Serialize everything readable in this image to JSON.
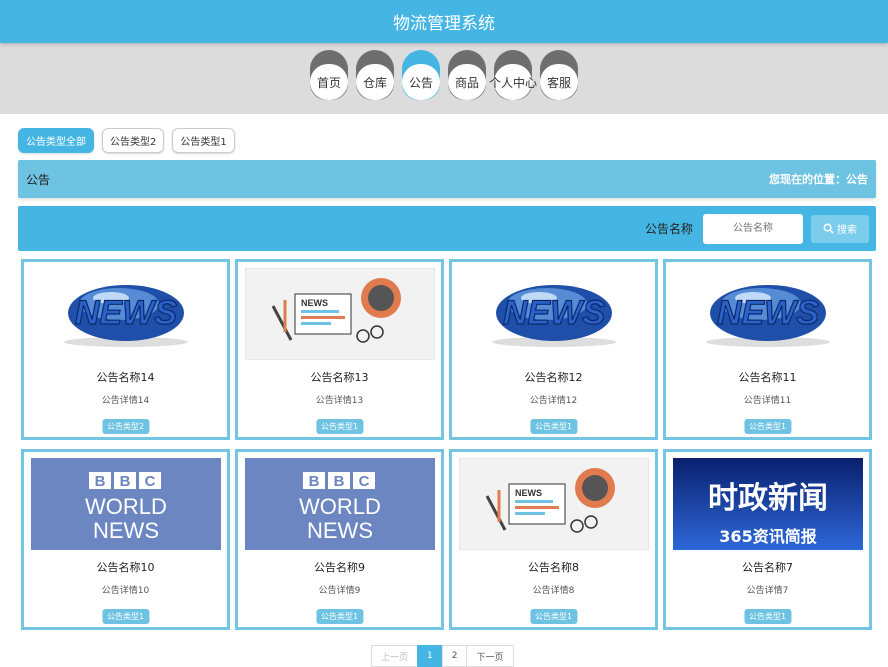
{
  "header": {
    "title": "物流管理系统"
  },
  "nav": [
    {
      "label": "首页"
    },
    {
      "label": "仓库"
    },
    {
      "label": "公告",
      "active": true
    },
    {
      "label": "商品"
    },
    {
      "label": "个人中心"
    },
    {
      "label": "客服"
    }
  ],
  "filters": [
    {
      "label": "公告类型全部",
      "active": true
    },
    {
      "label": "公告类型2"
    },
    {
      "label": "公告类型1"
    }
  ],
  "breadcrumb": {
    "section": "公告",
    "location": "您现在的位置：公告"
  },
  "search": {
    "label": "公告名称",
    "placeholder": "公告名称",
    "button": "搜索"
  },
  "cards": [
    {
      "image": "news-globe",
      "name": "公告名称14",
      "detail": "公告详情14",
      "type": "公告类型2"
    },
    {
      "image": "news-paper",
      "name": "公告名称13",
      "detail": "公告详情13",
      "type": "公告类型1"
    },
    {
      "image": "news-globe",
      "name": "公告名称12",
      "detail": "公告详情12",
      "type": "公告类型1"
    },
    {
      "image": "news-globe",
      "name": "公告名称11",
      "detail": "公告详情11",
      "type": "公告类型1"
    },
    {
      "image": "bbc-world-news",
      "name": "公告名称10",
      "detail": "公告详情10",
      "type": "公告类型1"
    },
    {
      "image": "bbc-world-news",
      "name": "公告名称9",
      "detail": "公告详情9",
      "type": "公告类型1"
    },
    {
      "image": "news-paper",
      "name": "公告名称8",
      "detail": "公告详情8",
      "type": "公告类型1"
    },
    {
      "image": "shizheng-news",
      "name": "公告名称7",
      "detail": "公告详情7",
      "type": "公告类型1"
    }
  ],
  "image_text": {
    "news": "NEWS",
    "bbc": [
      "B",
      "B",
      "C"
    ],
    "world": "WORLD",
    "bbc_news": "NEWS",
    "shizheng_title": "时政新闻",
    "shizheng_sub": "365资讯简报"
  },
  "pagination": {
    "prev": "上一页",
    "pages": [
      "1",
      "2"
    ],
    "current": "1",
    "next": "下一页"
  },
  "colors": {
    "primary": "#45b6e4",
    "card_border": "#72c6e2",
    "breadcrumb": "#6ec3e3",
    "nav_inactive": "#6e6e6e"
  }
}
